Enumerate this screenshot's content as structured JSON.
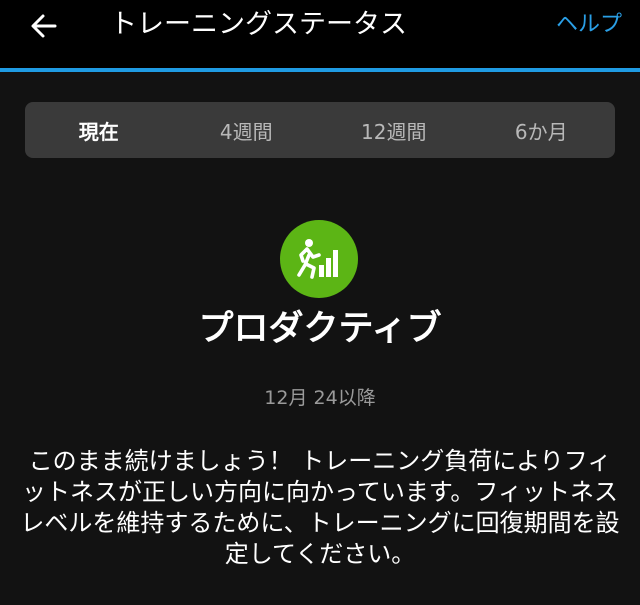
{
  "header": {
    "back_icon": "arrow-left-icon",
    "title": "トレーニングステータス",
    "help_label": "ヘルプ"
  },
  "tabs": [
    {
      "label": "現在",
      "active": true
    },
    {
      "label": "4週間",
      "active": false
    },
    {
      "label": "12週間",
      "active": false
    },
    {
      "label": "6か月",
      "active": false
    }
  ],
  "status": {
    "icon": "runner-bars-icon",
    "icon_color": "#5cb515",
    "title": "プロダクティブ",
    "date": "12月 24以降",
    "message": "このまま続けましょう！ トレーニング負荷によりフィットネスが正しい方向に向かっています。フィットネスレベルを維持するために、トレーニングに回復期間を設定してください。"
  },
  "colors": {
    "accent": "#1f9be3",
    "help_link": "#2a9fe6",
    "background": "#121212",
    "header_background": "#000000",
    "tab_bar": "#3a3a3a"
  }
}
